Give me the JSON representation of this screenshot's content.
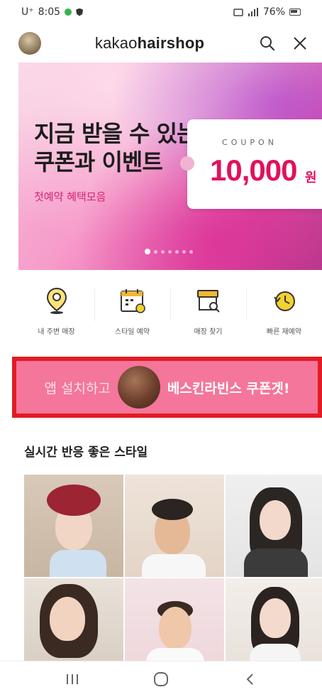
{
  "status": {
    "carrier": "U⁺",
    "time": "8:05",
    "battery": "76%"
  },
  "appbar": {
    "brand_light": "kakao",
    "brand_bold": "hairshop"
  },
  "banner": {
    "title_line1": "지금 받을 수 있는",
    "title_line2": "쿠폰과 이벤트",
    "subtitle": "첫예약 혜택모음",
    "coupon_label": "COUPON",
    "coupon_amount": "10,000",
    "coupon_unit": "원"
  },
  "quick_menu": [
    {
      "label": "내 주변 매장",
      "icon": "location-pin-icon"
    },
    {
      "label": "스타일 예약",
      "icon": "calendar-icon"
    },
    {
      "label": "매장 찾기",
      "icon": "store-search-icon"
    },
    {
      "label": "빠른 재예약",
      "icon": "clock-refresh-icon"
    }
  ],
  "promo": {
    "text_left": "앱 설치하고",
    "text_right": "베스킨라빈스 쿠폰겟!",
    "highlight_color": "#e31b23"
  },
  "section": {
    "title": "실시간 반응 좋은 스타일"
  },
  "styles": [
    "style-photo-1",
    "style-photo-2",
    "style-photo-3",
    "style-photo-4",
    "style-photo-5",
    "style-photo-6"
  ],
  "nav": [
    "recent-apps-icon",
    "home-icon",
    "back-icon"
  ],
  "colors": {
    "brand_pink": "#e0115f",
    "promo_bg": "#f4769a"
  }
}
